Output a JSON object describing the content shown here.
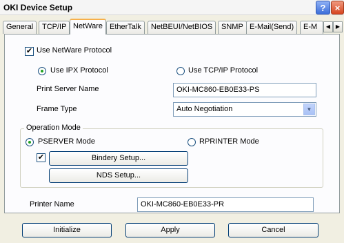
{
  "window": {
    "title": "OKI Device Setup",
    "help_glyph": "?",
    "close_glyph": "×"
  },
  "tabs": [
    {
      "label": "General"
    },
    {
      "label": "TCP/IP"
    },
    {
      "label": "NetWare"
    },
    {
      "label": "EtherTalk"
    },
    {
      "label": "NetBEUI/NetBIOS"
    },
    {
      "label": "SNMP"
    },
    {
      "label": "E-Mail(Send)"
    },
    {
      "label": "E-M"
    }
  ],
  "tab_scroll": {
    "left_glyph": "◀",
    "right_glyph": "▶"
  },
  "netware": {
    "use_protocol": {
      "label": "Use NetWare Protocol",
      "checked": true
    },
    "protocol_options": [
      {
        "label": "Use IPX Protocol",
        "selected": true
      },
      {
        "label": "Use TCP/IP Protocol",
        "selected": false
      }
    ],
    "print_server_name": {
      "label": "Print Server Name",
      "value": "OKI-MC860-EB0E33-PS"
    },
    "frame_type": {
      "label": "Frame Type",
      "value": "Auto Negotiation"
    },
    "operation_mode": {
      "title": "Operation Mode",
      "options": [
        {
          "label": "PSERVER Mode",
          "selected": true
        },
        {
          "label": "RPRINTER Mode",
          "selected": false
        }
      ],
      "bindery_checked": true,
      "bindery_button": "Bindery Setup...",
      "nds_button": "NDS Setup..."
    },
    "printer_name": {
      "label": "Printer Name",
      "value": "OKI-MC860-EB0E33-PR"
    }
  },
  "footer": {
    "initialize": "Initialize",
    "apply": "Apply",
    "cancel": "Cancel"
  },
  "check_glyph": "✔",
  "dropdown_glyph": "▼"
}
